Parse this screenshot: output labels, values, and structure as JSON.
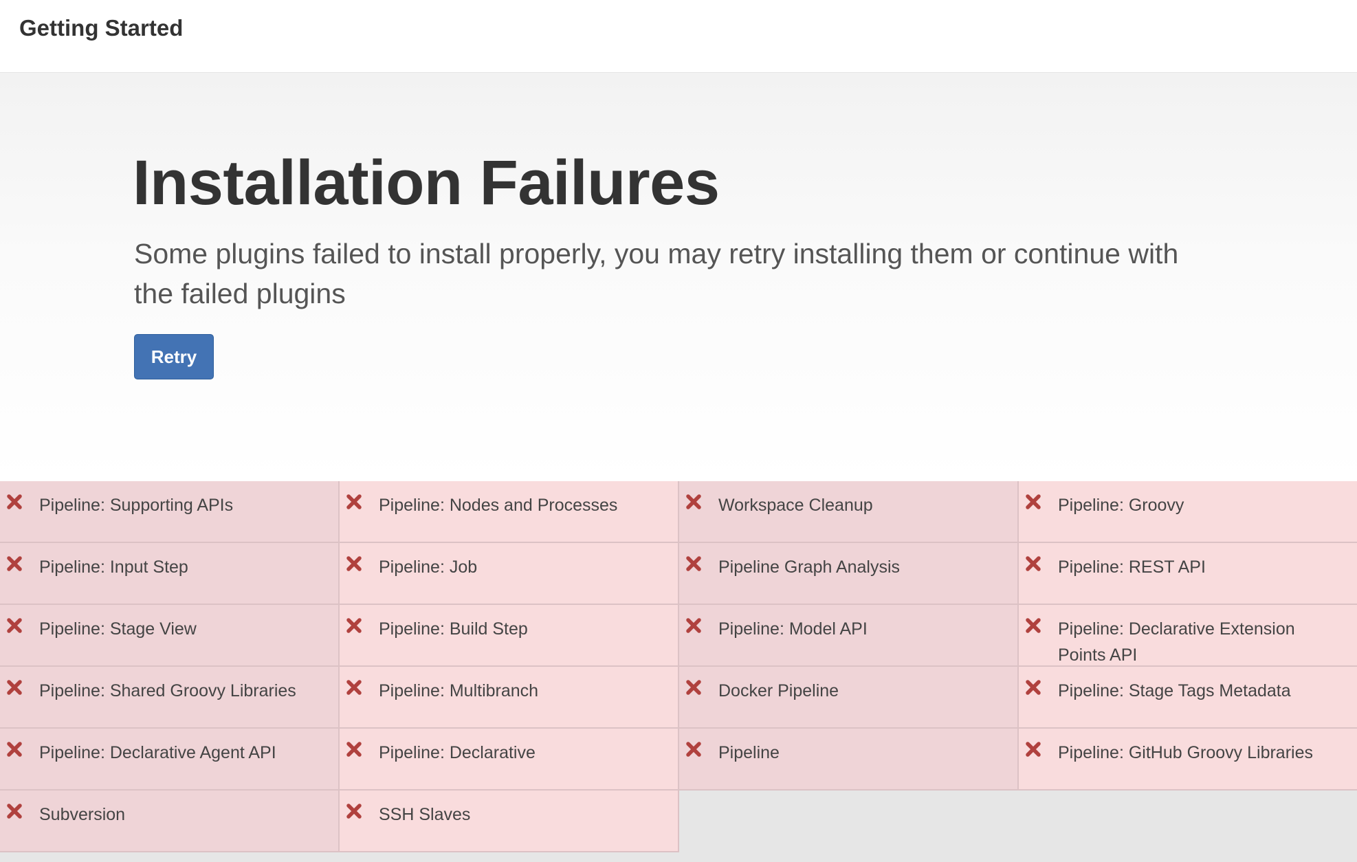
{
  "header": {
    "title": "Getting Started"
  },
  "main": {
    "heading": "Installation Failures",
    "description": "Some plugins failed to install properly, you may retry installing them or continue with the failed plugins",
    "retry_label": "Retry"
  },
  "colors": {
    "accent": "#4373b4",
    "error_icon": "#b0413e",
    "failed_tile": "#f9dcdd",
    "failed_tile_alt": "#efd4d7"
  },
  "plugins": [
    {
      "name": "Pipeline: Supporting APIs",
      "status": "failed",
      "icon": "close-icon"
    },
    {
      "name": "Pipeline: Nodes and Processes",
      "status": "failed",
      "icon": "close-icon"
    },
    {
      "name": "Workspace Cleanup",
      "status": "failed",
      "icon": "close-icon"
    },
    {
      "name": "Pipeline: Groovy",
      "status": "failed",
      "icon": "close-icon"
    },
    {
      "name": "Pipeline: Input Step",
      "status": "failed",
      "icon": "close-icon"
    },
    {
      "name": "Pipeline: Job",
      "status": "failed",
      "icon": "close-icon"
    },
    {
      "name": "Pipeline Graph Analysis",
      "status": "failed",
      "icon": "close-icon"
    },
    {
      "name": "Pipeline: REST API",
      "status": "failed",
      "icon": "close-icon"
    },
    {
      "name": "Pipeline: Stage View",
      "status": "failed",
      "icon": "close-icon"
    },
    {
      "name": "Pipeline: Build Step",
      "status": "failed",
      "icon": "close-icon"
    },
    {
      "name": "Pipeline: Model API",
      "status": "failed",
      "icon": "close-icon"
    },
    {
      "name": "Pipeline: Declarative Extension Points API",
      "status": "failed",
      "icon": "close-icon"
    },
    {
      "name": "Pipeline: Shared Groovy Libraries",
      "status": "failed",
      "icon": "close-icon"
    },
    {
      "name": "Pipeline: Multibranch",
      "status": "failed",
      "icon": "close-icon"
    },
    {
      "name": "Docker Pipeline",
      "status": "failed",
      "icon": "close-icon"
    },
    {
      "name": "Pipeline: Stage Tags Metadata",
      "status": "failed",
      "icon": "close-icon"
    },
    {
      "name": "Pipeline: Declarative Agent API",
      "status": "failed",
      "icon": "close-icon"
    },
    {
      "name": "Pipeline: Declarative",
      "status": "failed",
      "icon": "close-icon"
    },
    {
      "name": "Pipeline",
      "status": "failed",
      "icon": "close-icon"
    },
    {
      "name": "Pipeline: GitHub Groovy Libraries",
      "status": "failed",
      "icon": "close-icon"
    },
    {
      "name": "Subversion",
      "status": "failed",
      "icon": "close-icon"
    },
    {
      "name": "SSH Slaves",
      "status": "failed",
      "icon": "close-icon"
    }
  ]
}
